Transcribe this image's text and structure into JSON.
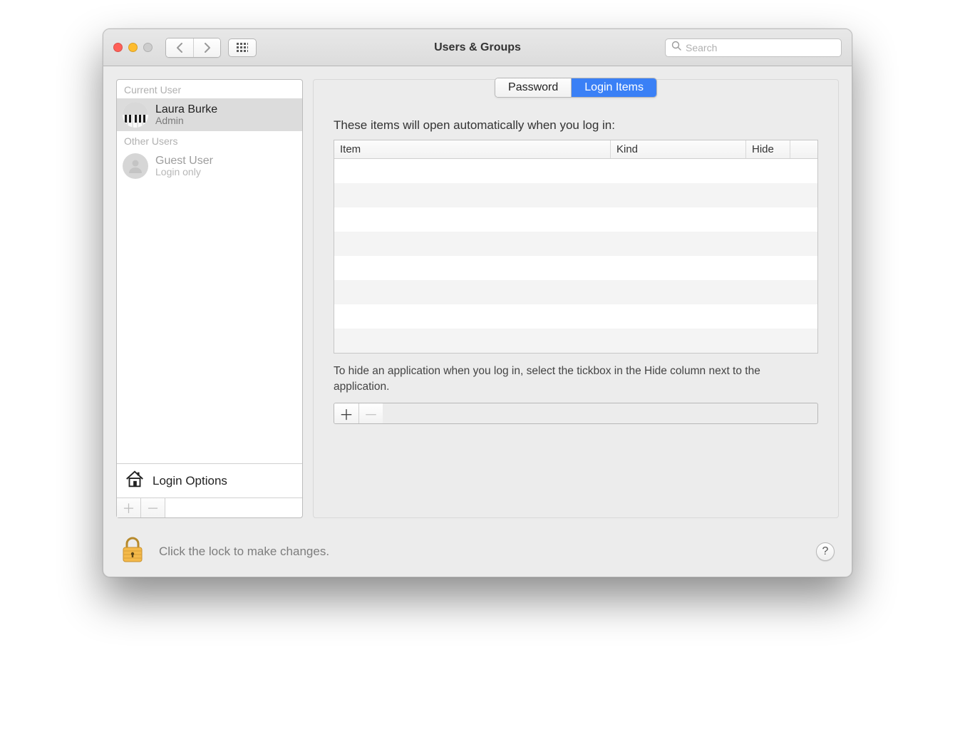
{
  "window": {
    "title": "Users & Groups",
    "search_placeholder": "Search"
  },
  "sidebar": {
    "current_user_label": "Current User",
    "other_users_label": "Other Users",
    "login_options_label": "Login Options",
    "current_user": {
      "name": "Laura Burke",
      "role": "Admin"
    },
    "other_user": {
      "name": "Guest User",
      "role": "Login only"
    }
  },
  "tabs": {
    "password": "Password",
    "login_items": "Login Items"
  },
  "main": {
    "heading": "These items will open automatically when you log in:",
    "columns": {
      "item": "Item",
      "kind": "Kind",
      "hide": "Hide"
    },
    "hint": "To hide an application when you log in, select the tickbox in the Hide column next to the application."
  },
  "footer": {
    "lock_text": "Click the lock to make changes.",
    "help_label": "?"
  }
}
